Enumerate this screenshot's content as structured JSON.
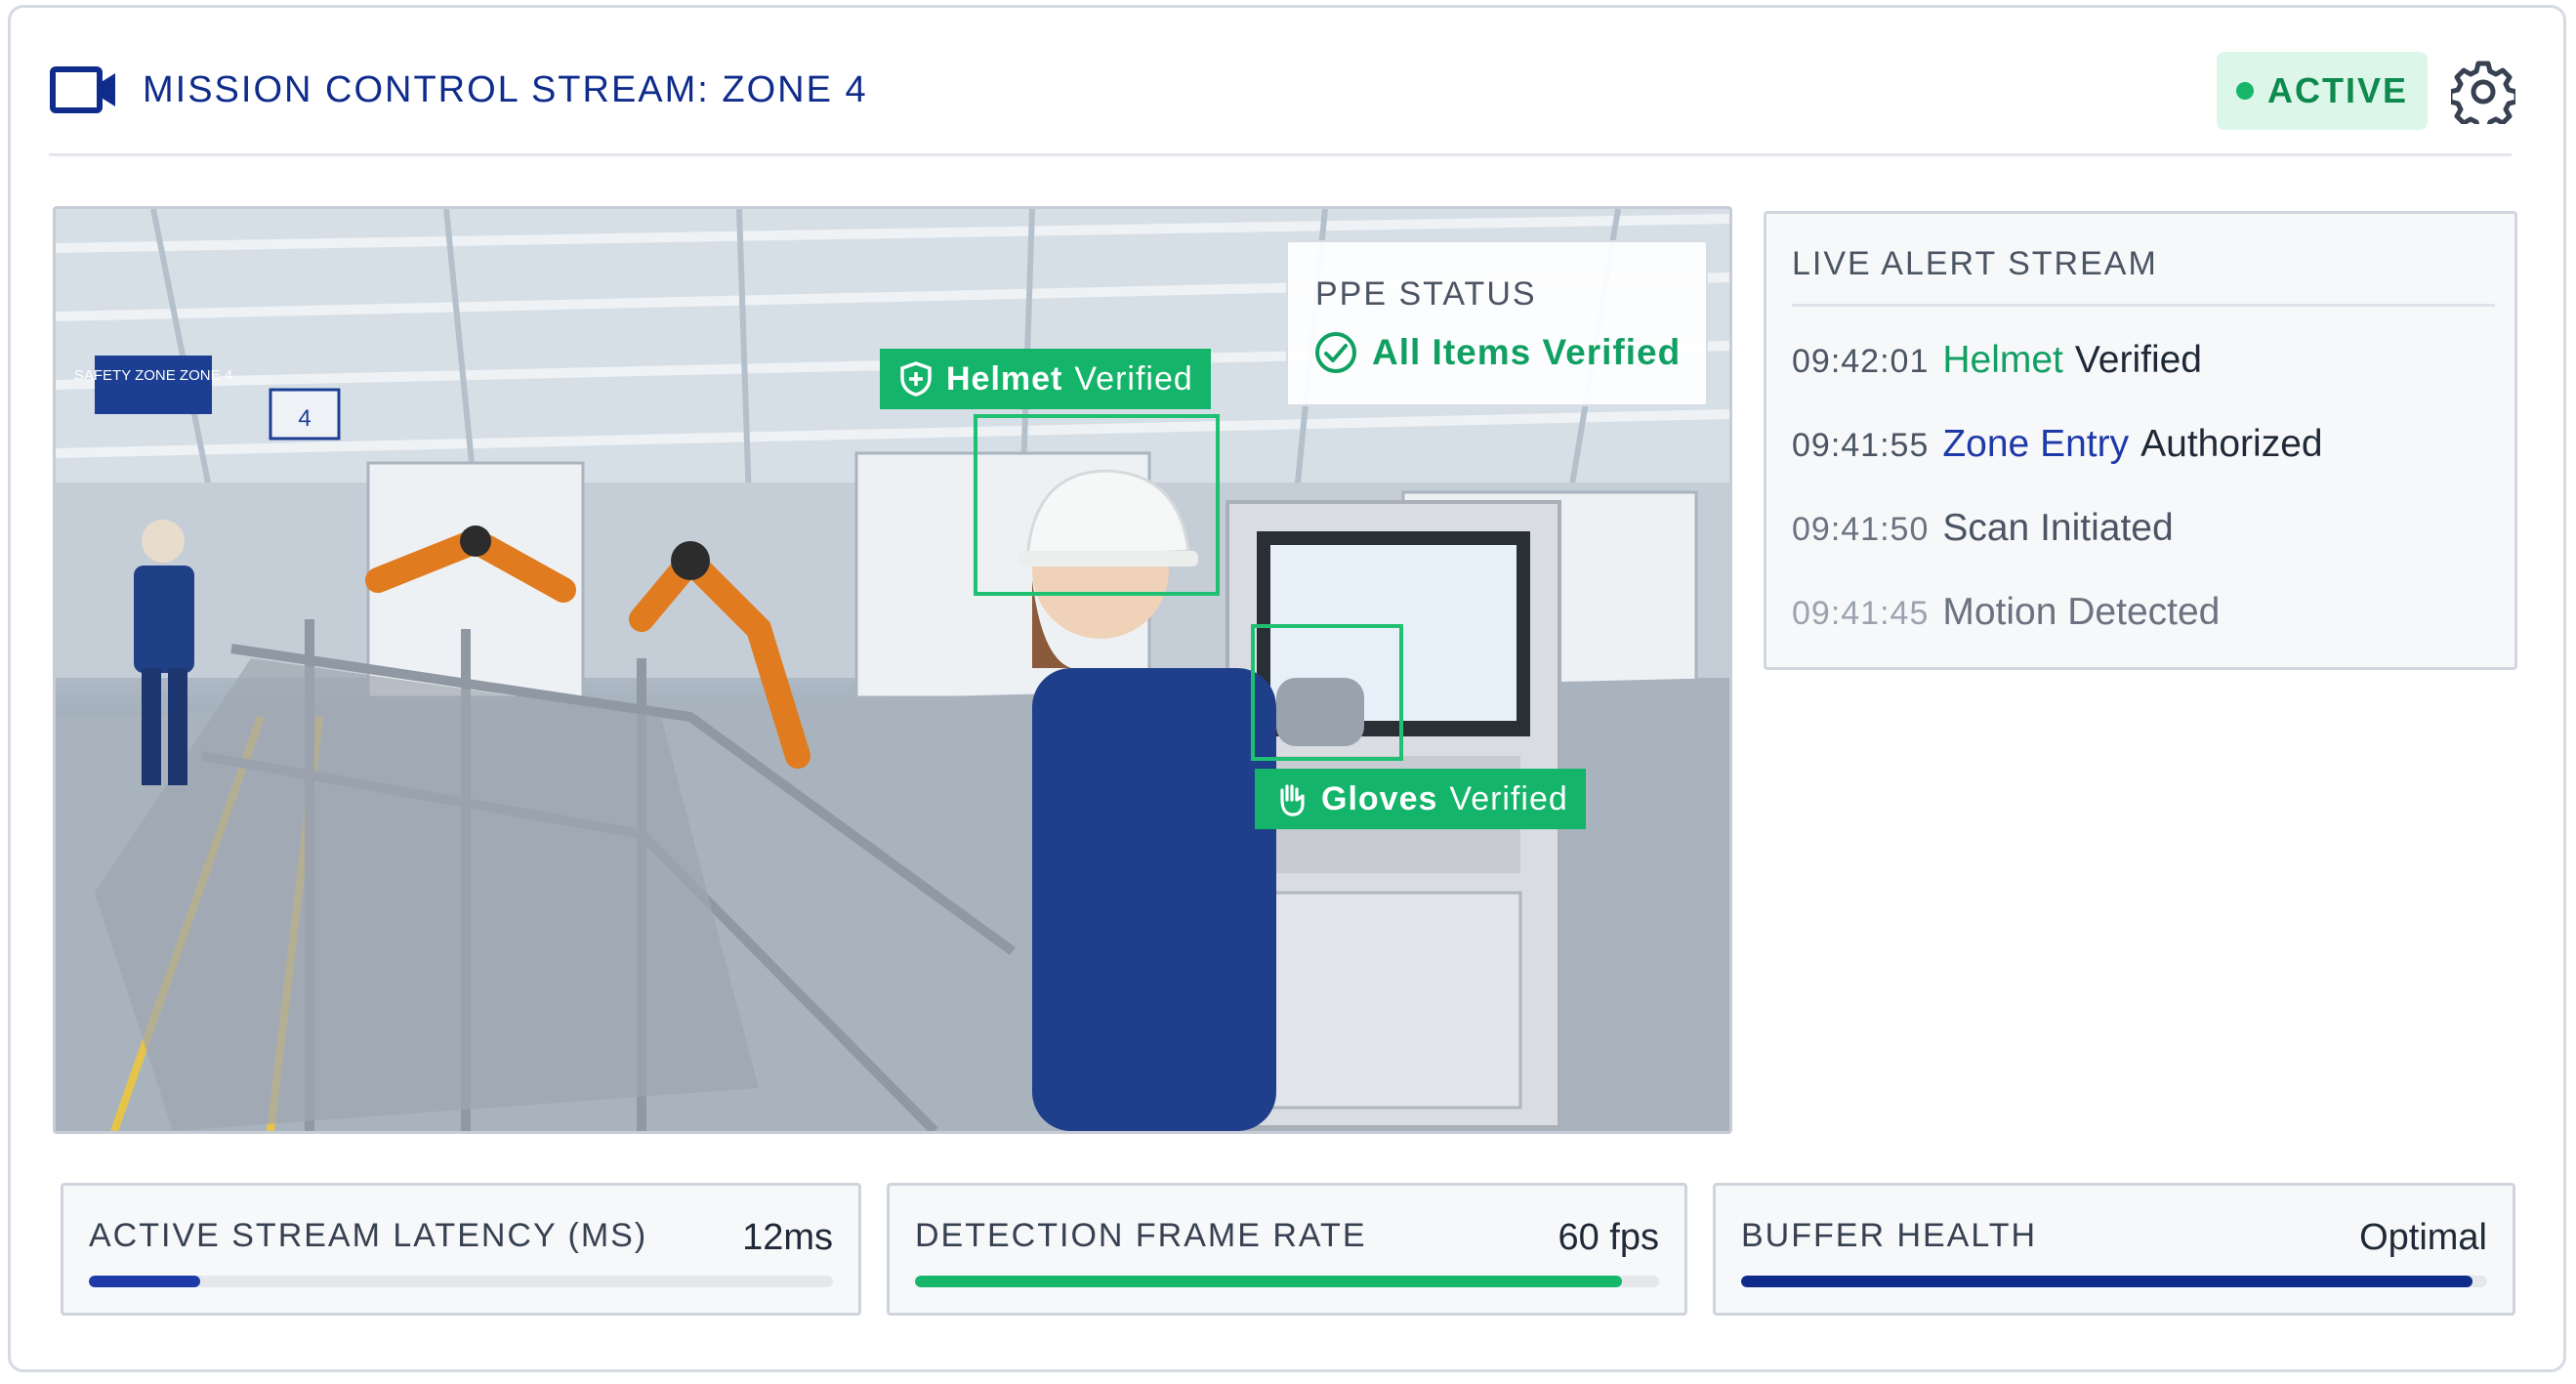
{
  "header": {
    "title": "MISSION CONTROL STREAM: ZONE 4",
    "camera_icon": "video-camera-icon",
    "status": "ACTIVE",
    "settings_icon": "gear-icon"
  },
  "feed": {
    "sign_text": "SAFETY ZONE ZONE 4",
    "sign_number": "4",
    "ppe_status": {
      "label": "PPE STATUS",
      "value": "All Items Verified",
      "icon": "check-circle-icon"
    },
    "detections": [
      {
        "item": "Helmet",
        "state": "Verified",
        "icon": "shield-plus-icon"
      },
      {
        "item": "Gloves",
        "state": "Verified",
        "icon": "hand-icon"
      }
    ]
  },
  "alerts": {
    "heading": "LIVE ALERT STREAM",
    "items": [
      {
        "time": "09:42:01",
        "highlight": "Helmet",
        "text": "Verified"
      },
      {
        "time": "09:41:55",
        "highlight": "Zone Entry",
        "text": "Authorized"
      },
      {
        "time": "09:41:50",
        "highlight": "",
        "text": "Scan Initiated"
      },
      {
        "time": "09:41:45",
        "highlight": "",
        "text": "Motion Detected"
      }
    ]
  },
  "metrics": [
    {
      "label": "ACTIVE STREAM LATENCY (MS)",
      "value": "12ms",
      "level": 0.15,
      "color": "#1e3aa8"
    },
    {
      "label": "DETECTION FRAME RATE",
      "value": "60 fps",
      "level": 0.95,
      "color": "#16b66b"
    },
    {
      "label": "BUFFER HEALTH",
      "value": "Optimal",
      "level": 0.98,
      "color": "#0f2c8c"
    }
  ],
  "colors": {
    "brand_blue": "#0f2c8c",
    "success_green": "#10a062",
    "detection_green": "#20c073"
  }
}
